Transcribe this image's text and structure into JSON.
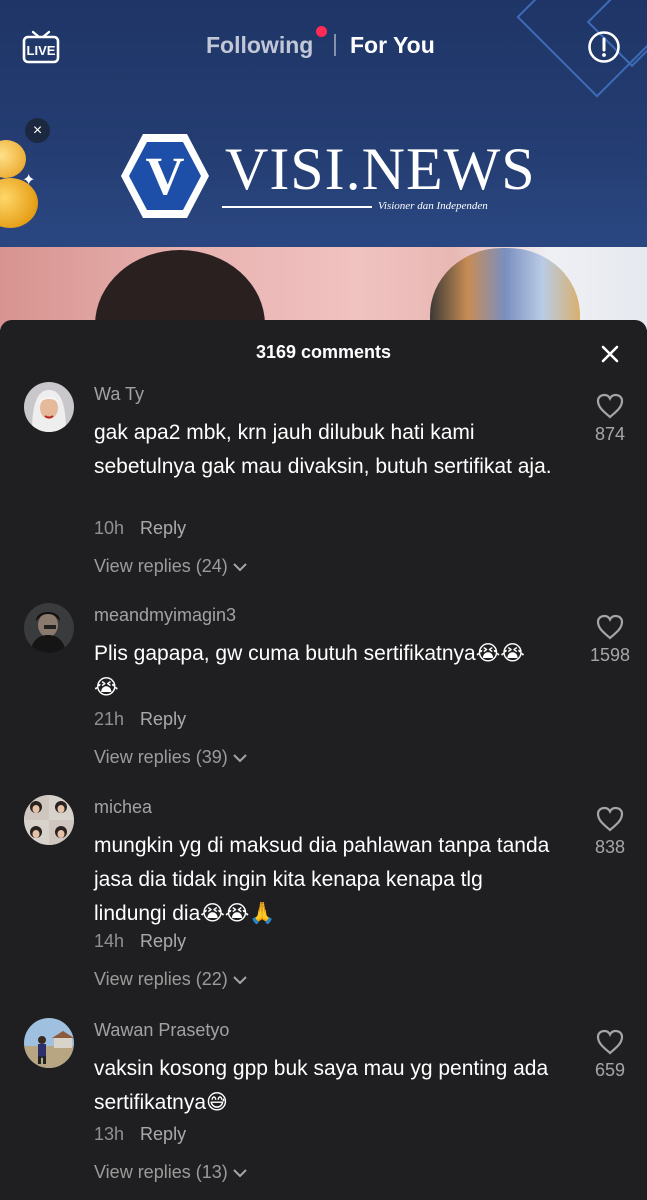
{
  "top_bar": {
    "live_label": "LIVE",
    "tab_following": "Following",
    "tab_foryou": "For You",
    "info_icon": "info-circle-icon"
  },
  "video": {
    "brand": "VISI.NEWS",
    "brand_tagline": "Visioner dan Independen",
    "brand_letter": "V"
  },
  "comments_panel": {
    "title": "3169 comments",
    "close_icon": "close-icon",
    "comments": [
      {
        "username": "Wa Ty",
        "text": "gak apa2 mbk, krn jauh dilubuk hati kami sebetulnya gak mau divaksin, butuh sertifikat aja.",
        "time": "10h",
        "reply_label": "Reply",
        "view_replies": "View replies (24)",
        "likes": "874"
      },
      {
        "username": "meandmyimagin3",
        "text": "Plis gapapa, gw cuma butuh sertifikatnya😭😭😭",
        "time": "21h",
        "reply_label": "Reply",
        "view_replies": "View replies (39)",
        "likes": "1598"
      },
      {
        "username": "michea",
        "text": "mungkin yg di maksud dia pahlawan tanpa tanda jasa dia tidak ingin kita kenapa kenapa tlg lindungi dia😭😭🙏",
        "time": "14h",
        "reply_label": "Reply",
        "view_replies": "View replies (22)",
        "likes": "838"
      },
      {
        "username": "Wawan Prasetyo",
        "text": "vaksin kosong gpp buk saya mau yg penting ada sertifikatnya😅",
        "time": "13h",
        "reply_label": "Reply",
        "view_replies": "View replies (13)",
        "likes": "659"
      }
    ]
  },
  "colors": {
    "sheet_bg": "#1f1f21",
    "notification_dot": "#fe2c55",
    "video_bg": "#243d72"
  }
}
